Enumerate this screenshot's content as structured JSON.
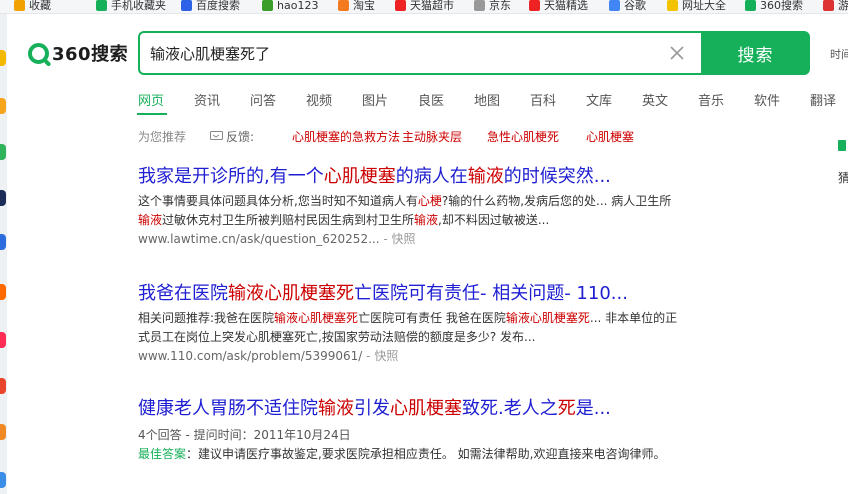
{
  "bookmarks": [
    {
      "label": "收藏",
      "icon": "star-icon",
      "color": "#f2a200"
    },
    {
      "label": "手机收藏夹",
      "icon": "phone-icon",
      "color": "#17b05a"
    },
    {
      "label": "百度搜索",
      "icon": "paw-icon",
      "color": "#2d62e8"
    },
    {
      "label": "hao123",
      "icon": "hao123-icon",
      "color": "#3c9e2a"
    },
    {
      "label": "淘宝",
      "icon": "taobao-icon",
      "color": "#f47a20"
    },
    {
      "label": "天猫超市",
      "icon": "tmall-icon",
      "color": "#e22"
    },
    {
      "label": "京东",
      "icon": "page-icon",
      "color": "#999999"
    },
    {
      "label": "天猫精选",
      "icon": "tmall-icon",
      "color": "#e22"
    },
    {
      "label": "谷歌",
      "icon": "google-icon",
      "color": "#4285f4"
    },
    {
      "label": "网址大全",
      "icon": "plus-icon",
      "color": "#f4c300"
    },
    {
      "label": "360搜索",
      "icon": "360-icon",
      "color": "#17b05a"
    },
    {
      "label": "游",
      "icon": "game-icon",
      "color": "#d33"
    }
  ],
  "logo": {
    "text": "360搜索"
  },
  "search": {
    "value": "输液心肌梗塞死了",
    "button": "搜索"
  },
  "side_link": "时间",
  "tabs": [
    "网页",
    "资讯",
    "问答",
    "视频",
    "图片",
    "良医",
    "地图",
    "百科",
    "文库",
    "英文",
    "音乐",
    "软件",
    "翻译"
  ],
  "recommend": {
    "label": "为您推荐",
    "feedback": "反馈:",
    "terms": [
      "心肌梗塞的急救方法",
      "主动脉夹层",
      "急性心肌梗死",
      "心肌梗塞"
    ]
  },
  "results": [
    {
      "title": [
        {
          "t": "我家是开诊所的,有一个"
        },
        {
          "t": "心肌梗塞",
          "hl": true
        },
        {
          "t": "的病人在"
        },
        {
          "t": "输液",
          "hl": true
        },
        {
          "t": "的时候突然..."
        }
      ],
      "snippet": [
        {
          "t": "这个事情要具体问题具体分析,您当时知不知道病人有"
        },
        {
          "t": "心梗",
          "hl": true
        },
        {
          "t": "?输的什么药物,发病后您的处... 病人卫生所"
        },
        {
          "t": "输液",
          "hl": true
        },
        {
          "t": "过敏休克村卫生所被判赔村民因生病到村卫生所"
        },
        {
          "t": "输液",
          "hl": true
        },
        {
          "t": ",却不料因过敏被送..."
        }
      ],
      "url": "www.lawtime.cn/ask/question_620252...",
      "snapshot": "快照"
    },
    {
      "title": [
        {
          "t": "我爸在医院"
        },
        {
          "t": "输液心肌梗塞死",
          "hl": true
        },
        {
          "t": "亡医院可有责任- 相关问题- 110..."
        }
      ],
      "snippet": [
        {
          "t": "相关问题推荐:我爸在医院"
        },
        {
          "t": "输液心肌梗塞死",
          "hl": true
        },
        {
          "t": "亡医院可有责任 我爸在医院"
        },
        {
          "t": "输液心肌梗塞死",
          "hl": true
        },
        {
          "t": "... 非本单位的正式员工在岗位上突发心肌梗塞死亡,按国家劳动法赔偿的额度是多少? 发布..."
        }
      ],
      "url": "www.110.com/ask/problem/5399061/",
      "snapshot": "快照"
    },
    {
      "title": [
        {
          "t": "健康老人胃肠不适住院"
        },
        {
          "t": "输液",
          "hl": true
        },
        {
          "t": "引发"
        },
        {
          "t": "心肌梗塞",
          "hl": true
        },
        {
          "t": "致死.老人之"
        },
        {
          "t": "死",
          "hl": true
        },
        {
          "t": "是..."
        }
      ],
      "meta": "4个回答 - 提问时间：2011年10月24日",
      "best_label": "最佳答案",
      "best_text": "：建议申请医疗事故鉴定,要求医院承担相应责任。 如需法律帮助,欢迎直接来电咨询律师。"
    }
  ],
  "right_col": {
    "text": "猜"
  }
}
